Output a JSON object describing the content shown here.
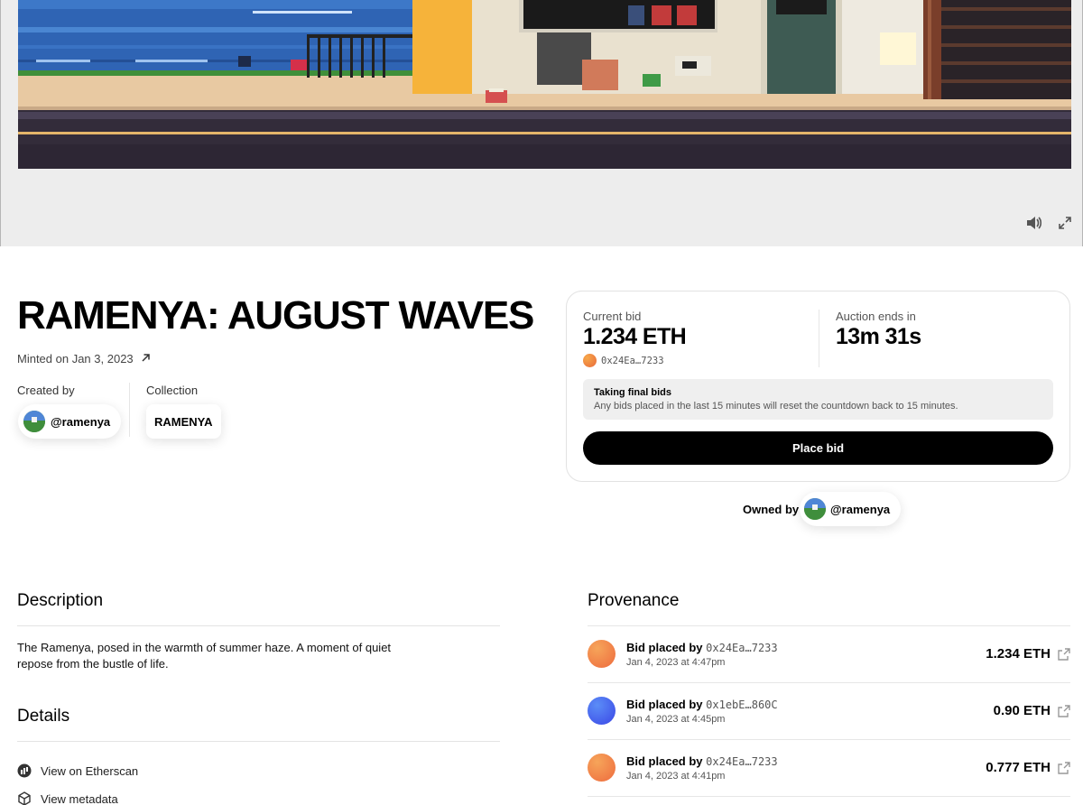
{
  "media": {
    "sound_icon": "speaker-icon",
    "fullscreen_icon": "expand-icon"
  },
  "artwork": {
    "title": "RAMENYA: AUGUST WAVES",
    "minted_label": "Minted on Jan 3, 2023",
    "created_by_label": "Created by",
    "creator_handle": "@ramenya",
    "collection_label": "Collection",
    "collection_name": "RAMENYA"
  },
  "auction": {
    "current_bid_label": "Current bid",
    "current_bid_value": "1.234 ETH",
    "bidder_address": "0x24Ea…7233",
    "ends_label": "Auction ends in",
    "ends_value": "13m 31s",
    "notice_title": "Taking final bids",
    "notice_text": "Any bids placed in the last 15 minutes will reset the countdown back to 15 minutes.",
    "place_bid_label": "Place bid",
    "owned_by_label": "Owned by",
    "owner_handle": "@ramenya"
  },
  "description": {
    "heading": "Description",
    "text": "The Ramenya, posed in the warmth of summer haze. A moment of quiet repose from the bustle of life."
  },
  "details": {
    "heading": "Details",
    "etherscan_label": "View on Etherscan",
    "metadata_label": "View metadata"
  },
  "provenance": {
    "heading": "Provenance",
    "rows": [
      {
        "prefix": "Bid placed by",
        "address": "0x24Ea…7233",
        "date": "Jan 4, 2023 at 4:47pm",
        "amount": "1.234 ETH",
        "avatar": "orange"
      },
      {
        "prefix": "Bid placed by",
        "address": "0x1ebE…860C",
        "date": "Jan 4, 2023 at 4:45pm",
        "amount": "0.90 ETH",
        "avatar": "blue"
      },
      {
        "prefix": "Bid placed by",
        "address": "0x24Ea…7233",
        "date": "Jan 4, 2023 at 4:41pm",
        "amount": "0.777 ETH",
        "avatar": "orange"
      }
    ]
  },
  "colors": {
    "accent": "#000000",
    "notice_bg": "#efefef",
    "hero_bg": "#ededed"
  }
}
